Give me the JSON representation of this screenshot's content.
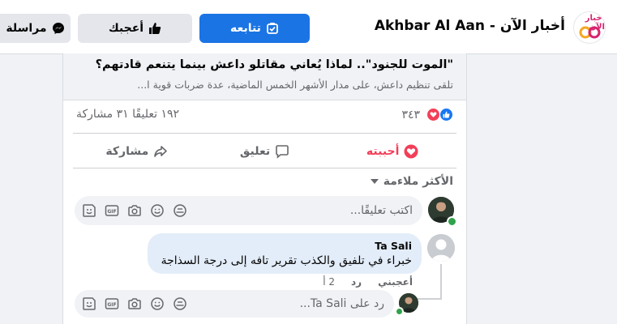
{
  "header": {
    "logo_text": "أخبار الآن",
    "page_name": "Akhbar Al Aan - أخبار الآن",
    "follow_label": "تتابعه",
    "like_label": "أعجبك",
    "message_label": "مراسلة"
  },
  "post": {
    "link_title": "\"الموت للجنود\".. لماذا يُعاني مقاتلو داعش بينما يتنعم قادتهم؟",
    "link_description": "تلقى تنظيم داعش، على مدار الأشهر الخمس الماضية، عدة ضربات قوية ا...",
    "reaction_count": "٣٤٣",
    "comments_shares": "١٩٢ تعليقًا ٣١ مشاركة",
    "actions": {
      "like": "أحببته",
      "comment": "تعليق",
      "share": "مشاركة"
    }
  },
  "comments_section": {
    "sort_label": "الأكثر ملاءمة",
    "write_placeholder": "اكتب تعليقًا...",
    "comment": {
      "author": "Ta Sali",
      "text": "خبراء في تلفيق والكذب تقرير تافه إلى درجة السذاجة",
      "like_action": "أعجبني",
      "reply_action": "رد",
      "age": "2 أ"
    },
    "reply_placeholder": "رد على Ta Sali..."
  },
  "colors": {
    "accent": "#1b74e4",
    "love": "#f33e58",
    "secondary_text": "#65676b",
    "bubble": "#e3edf9"
  }
}
